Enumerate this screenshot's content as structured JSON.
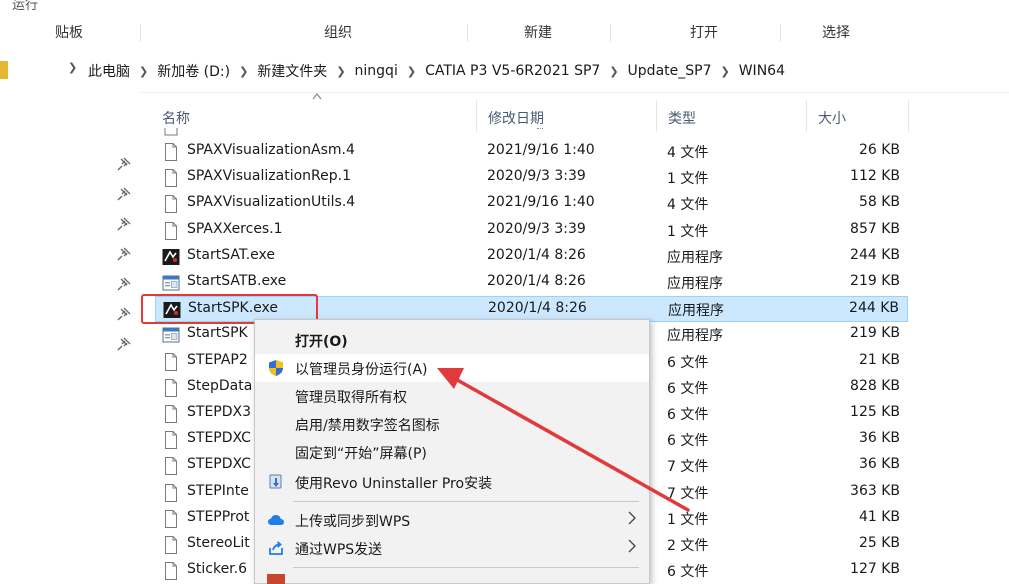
{
  "ribbon": {
    "top_cut": "运行",
    "groups": [
      "贴板",
      "组织",
      "新建",
      "打开",
      "选择"
    ]
  },
  "breadcrumb": [
    "此电脑",
    "新加卷 (D:)",
    "新建文件夹",
    "ningqi",
    "CATIA P3 V5-6R2021 SP7",
    "Update_SP7",
    "WIN64"
  ],
  "columns": {
    "name": "名称",
    "date": "修改日期",
    "type": "类型",
    "size": "大小"
  },
  "files": [
    {
      "name": "SPAXVisualizationAsm.4",
      "date": "2021/9/16 1:40",
      "type": "4 文件",
      "size": "26 KB",
      "icon": "file-icon"
    },
    {
      "name": "SPAXVisualizationRep.1",
      "date": "2020/9/3 3:39",
      "type": "1 文件",
      "size": "112 KB",
      "icon": "file-icon"
    },
    {
      "name": "SPAXVisualizationUtils.4",
      "date": "2021/9/16 1:40",
      "type": "4 文件",
      "size": "58 KB",
      "icon": "file-icon"
    },
    {
      "name": "SPAXXerces.1",
      "date": "2020/9/3 3:39",
      "type": "1 文件",
      "size": "857 KB",
      "icon": "file-icon"
    },
    {
      "name": "StartSAT.exe",
      "date": "2020/1/4 8:26",
      "type": "应用程序",
      "size": "244 KB",
      "icon": "catia-app-icon"
    },
    {
      "name": "StartSATB.exe",
      "date": "2020/1/4 8:26",
      "type": "应用程序",
      "size": "219 KB",
      "icon": "window-app-icon"
    },
    {
      "name": "StartSPK.exe",
      "date": "2020/1/4 8:26",
      "type": "应用程序",
      "size": "244 KB",
      "icon": "catia-app-icon"
    },
    {
      "name": "StartSPK",
      "date": "",
      "type": "应用程序",
      "size": "219 KB",
      "icon": "window-app-icon"
    },
    {
      "name": "STEPAP2",
      "date": "",
      "type": "6 文件",
      "size": "21 KB",
      "icon": "file-icon"
    },
    {
      "name": "StepData",
      "date": "",
      "type": "6 文件",
      "size": "828 KB",
      "icon": "file-icon"
    },
    {
      "name": "STEPDX3",
      "date": "",
      "type": "6 文件",
      "size": "125 KB",
      "icon": "file-icon"
    },
    {
      "name": "STEPDXC",
      "date": "",
      "type": "6 文件",
      "size": "36 KB",
      "icon": "file-icon"
    },
    {
      "name": "STEPDXC",
      "date": "",
      "type": "7 文件",
      "size": "36 KB",
      "icon": "file-icon"
    },
    {
      "name": "STEPInte",
      "date": "",
      "type": "7 文件",
      "size": "363 KB",
      "icon": "file-icon"
    },
    {
      "name": "STEPProt",
      "date": "",
      "type": "1 文件",
      "size": "41 KB",
      "icon": "file-icon"
    },
    {
      "name": "StereoLit",
      "date": "",
      "type": "2 文件",
      "size": "25 KB",
      "icon": "file-icon"
    },
    {
      "name": "Sticker.6",
      "date": "",
      "type": "6 文件",
      "size": "127 KB",
      "icon": "file-icon"
    }
  ],
  "selected_index": 6,
  "context_menu": {
    "open": "打开(O)",
    "run_as_admin": "以管理员身份运行(A)",
    "take_ownership": "管理员取得所有权",
    "toggle_signature": "启用/禁用数字签名图标",
    "pin_start": "固定到“开始”屏幕(P)",
    "revo": "使用Revo Uninstaller Pro安装",
    "wps_upload": "上传或同步到WPS",
    "wps_send": "通过WPS发送"
  },
  "colors": {
    "selection": "#cce8ff",
    "highlight_box": "#e23a3a",
    "arrow": "#e23a3a"
  }
}
